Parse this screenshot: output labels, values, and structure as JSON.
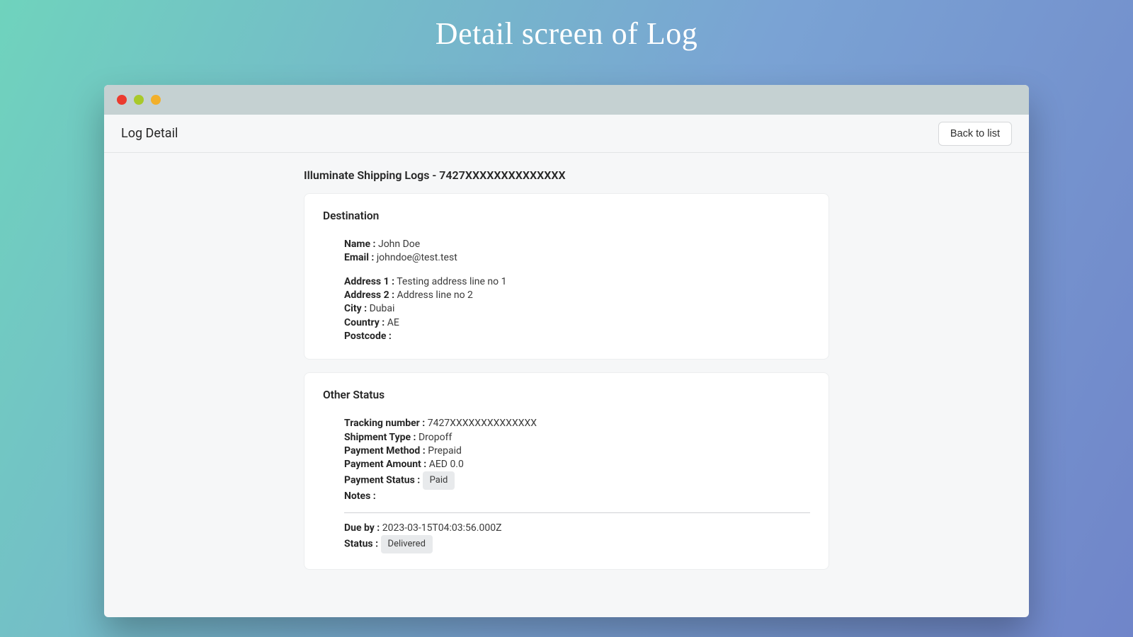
{
  "page_title": "Detail screen of Log",
  "topbar": {
    "title": "Log Detail",
    "back_label": "Back to list"
  },
  "heading": "Illuminate Shipping Logs - 7427XXXXXXXXXXXXXX",
  "destination": {
    "title": "Destination",
    "labels": {
      "name": "Name :",
      "email": "Email :",
      "address1": "Address 1 :",
      "address2": "Address 2 :",
      "city": "City :",
      "country": "Country :",
      "postcode": "Postcode :"
    },
    "values": {
      "name": "John Doe",
      "email": "johndoe@test.test",
      "address1": "Testing address line no 1",
      "address2": "Address line no 2",
      "city": "Dubai",
      "country": "AE",
      "postcode": ""
    }
  },
  "other": {
    "title": "Other Status",
    "labels": {
      "tracking": "Tracking number :",
      "shipment_type": "Shipment Type :",
      "payment_method": "Payment Method :",
      "payment_amount": "Payment Amount :",
      "payment_status": "Payment Status :",
      "notes": "Notes :",
      "due_by": "Due by :",
      "status": "Status :"
    },
    "values": {
      "tracking": "7427XXXXXXXXXXXXXX",
      "shipment_type": "Dropoff",
      "payment_method": "Prepaid",
      "payment_amount": "AED 0.0",
      "payment_status": "Paid",
      "notes": "",
      "due_by": "2023-03-15T04:03:56.000Z",
      "status": "Delivered"
    }
  }
}
